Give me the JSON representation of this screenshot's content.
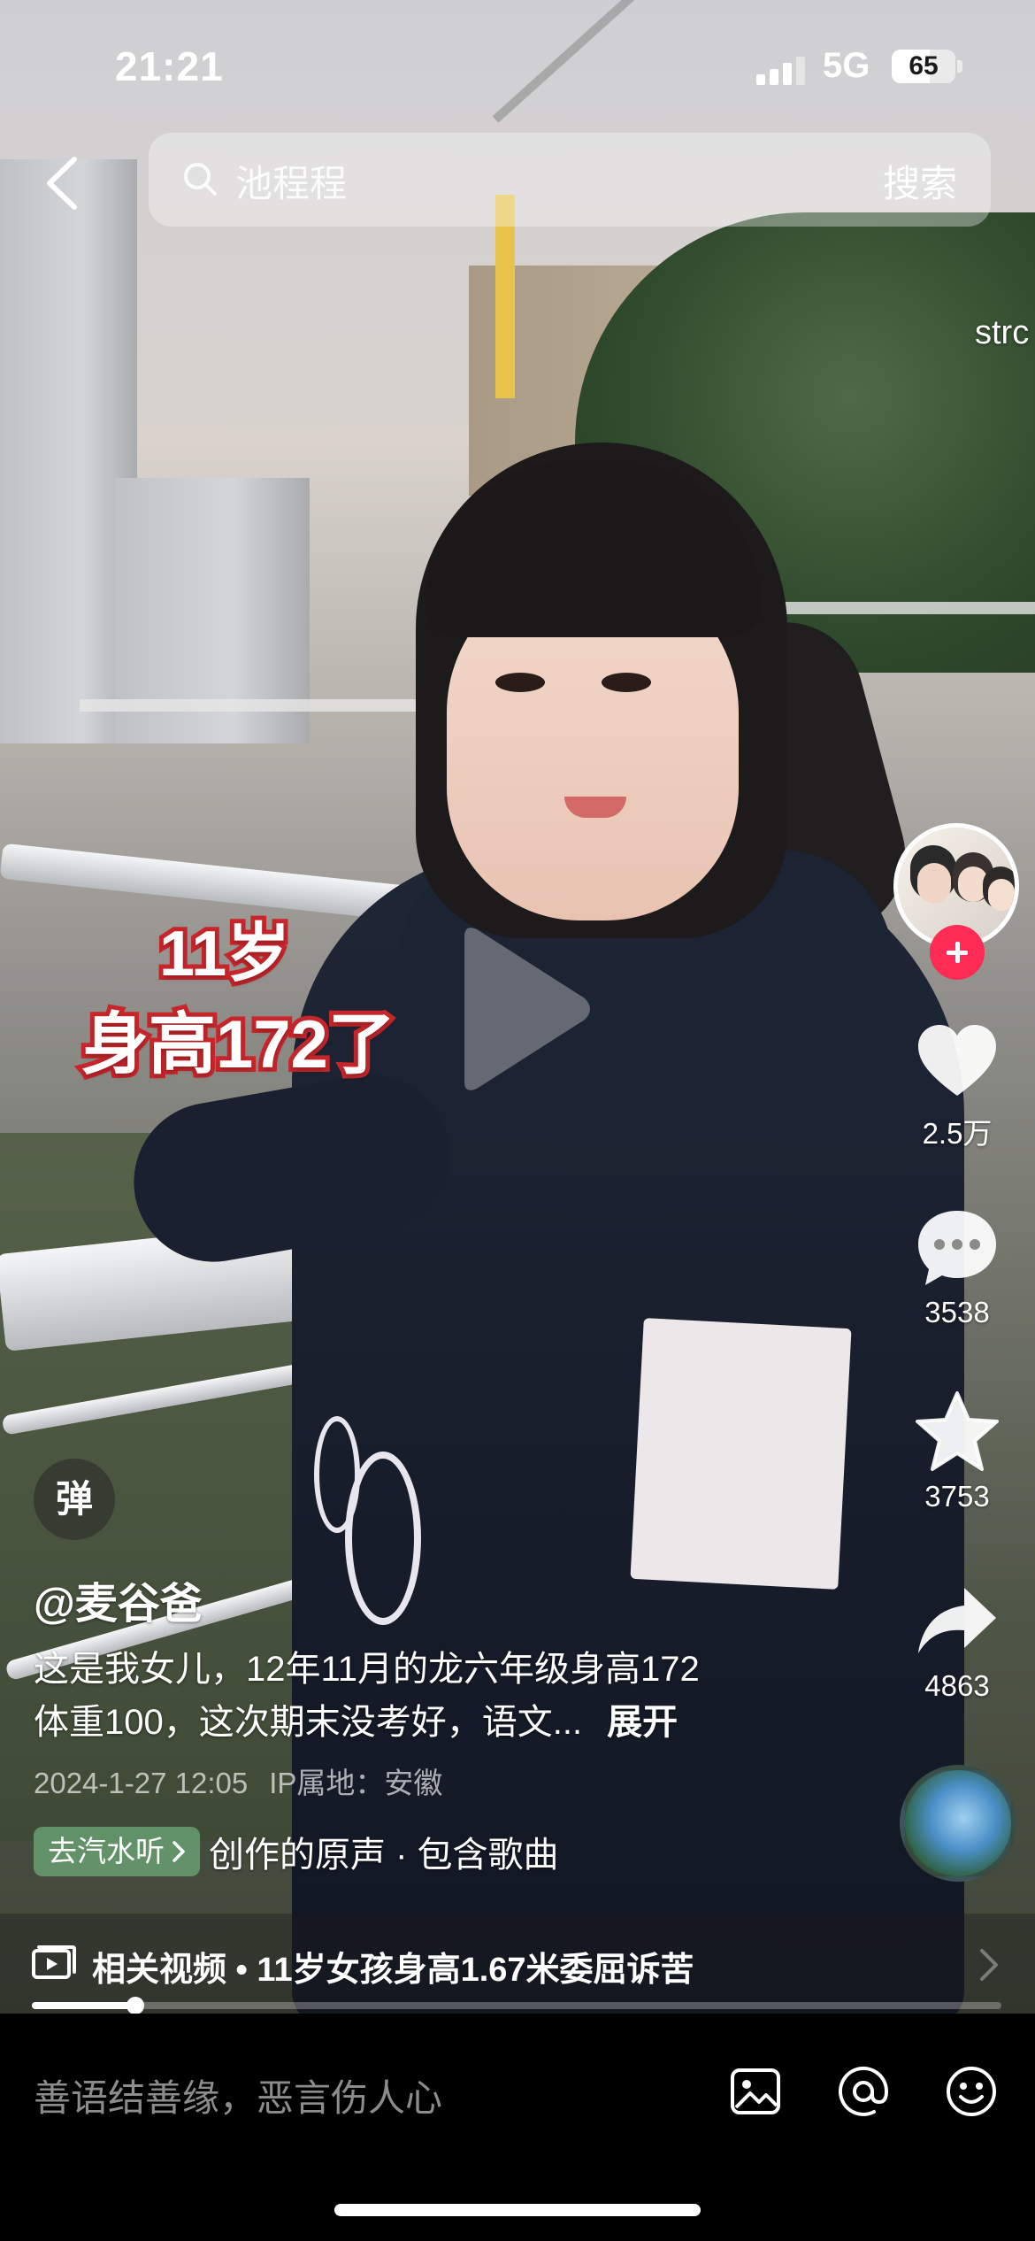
{
  "status_bar": {
    "time": "21:21",
    "network": "5G",
    "battery": "65"
  },
  "search": {
    "query": "池程程",
    "button_label": "搜索"
  },
  "edge_text": "strc",
  "video_overlay": {
    "line1": "11岁",
    "line2": "身高172了"
  },
  "actions": {
    "likes": "2.5万",
    "comments": "3538",
    "favorites": "3753",
    "shares": "4863"
  },
  "danmaku_label": "弹",
  "post": {
    "author": "@麦谷爸",
    "description_line1": "这是我女儿，12年11月的龙六年级身高172",
    "description_line2": "体重100，这次期末没考好，语文...",
    "expand_label": "展开",
    "date": "2024-1-27 12:05",
    "ip_location": "IP属地：安徽",
    "listen_label": "去汽水听",
    "music_text": "创作的原声 · 包含歌曲"
  },
  "related": {
    "text": "相关视频 • 11岁女孩身高1.67米委屈诉苦"
  },
  "progress": {
    "fraction": 0.107
  },
  "comment_bar": {
    "placeholder": "善语结善缘，恶言伤人心"
  },
  "colors": {
    "follow_red": "#fe2c55",
    "overlay_red": "#c8262b",
    "listen_green": "#6eaa78"
  },
  "icons": [
    "back-chevron-icon",
    "search-icon",
    "play-icon",
    "heart-icon",
    "comment-icon",
    "star-icon",
    "share-icon",
    "related-video-icon",
    "image-icon",
    "at-icon",
    "emoji-icon"
  ]
}
